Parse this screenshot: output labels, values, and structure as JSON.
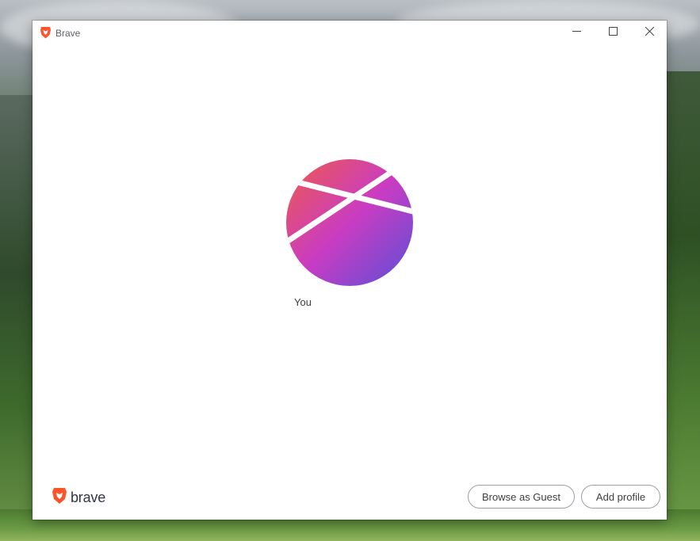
{
  "window": {
    "title": "Brave",
    "app_icon": "brave-lion-icon",
    "controls": [
      "minimize-icon",
      "maximize-icon",
      "close-icon"
    ]
  },
  "profiles": [
    {
      "name": "You",
      "avatar": "gradient-circle-avatar"
    }
  ],
  "footer": {
    "logo_text": "brave",
    "browse_as_guest": "Browse as Guest",
    "add_profile": "Add profile"
  },
  "colors": {
    "avatar_gradient_start": "#f05a4a",
    "avatar_gradient_mid": "#c93cc3",
    "avatar_gradient_end": "#5a4fd6",
    "brave_orange": "#fb542b",
    "button_border": "#9aa0a6"
  }
}
